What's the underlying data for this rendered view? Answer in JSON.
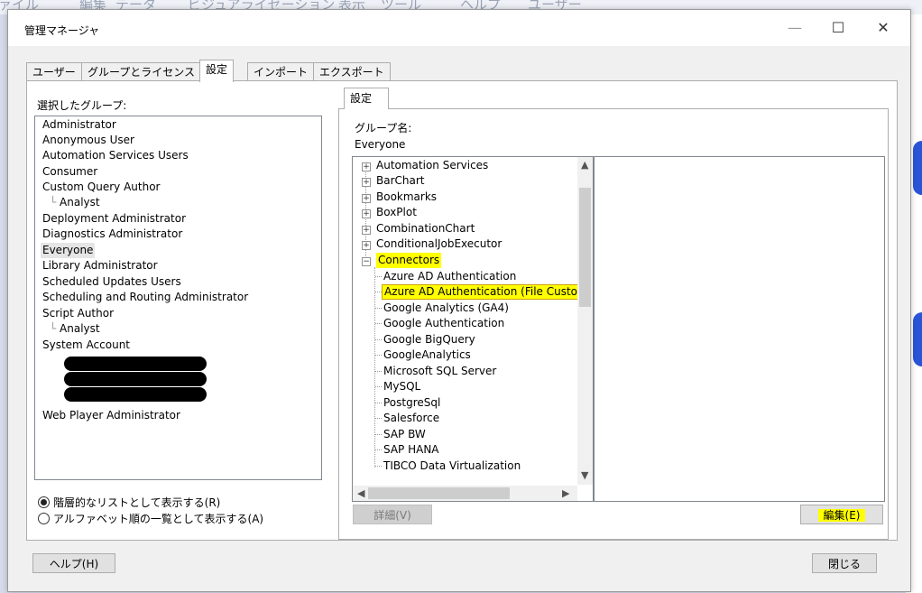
{
  "background_menu": [
    "ァイル",
    "編集",
    "データ",
    "ビジュアライゼーション",
    "表示",
    "ツール",
    "ヘルプ",
    "ユーザー"
  ],
  "window": {
    "title": "管理マネージャ",
    "minimize": "—",
    "maximize": "☐",
    "close": "✕"
  },
  "tabs": [
    "ユーザー",
    "グループとライセンス",
    "設定",
    "インポート",
    "エクスポート"
  ],
  "left": {
    "label": "選択したグループ:",
    "groups": [
      "Administrator",
      "Anonymous User",
      "Automation Services Users",
      "Consumer",
      "Custom Query Author",
      "Analyst",
      "Deployment Administrator",
      "Diagnostics Administrator",
      "Everyone",
      "Library Administrator",
      "Scheduled Updates Users",
      "Scheduling and Routing Administrator",
      "Script Author",
      "Analyst",
      "System Account",
      "Web Player Administrator"
    ],
    "selected": "Everyone",
    "radio_hierarchy": "階層的なリストとして表示する(R)",
    "radio_alpha": "アルファベット順の一覧として表示する(A)"
  },
  "settings": {
    "subtab": "設定",
    "group_name_label": "グループ名:",
    "group_name": "Everyone",
    "tree_top": [
      "Automation Services",
      "BarChart",
      "Bookmarks",
      "BoxPlot",
      "CombinationChart",
      "ConditionalJobExecutor"
    ],
    "tree_expanded": "Connectors",
    "connectors": [
      "Azure AD Authentication",
      "Azure AD Authentication (File Custom)",
      "Google Analytics (GA4)",
      "Google Authentication",
      "Google BigQuery",
      "GoogleAnalytics",
      "Microsoft SQL Server",
      "MySQL",
      "PostgreSql",
      "Salesforce",
      "SAP BW",
      "SAP HANA",
      "TIBCO Data Virtualization"
    ],
    "highlighted_connector": "Azure AD Authentication (File Custom)",
    "highlight_color": "#ffff00",
    "details_button": "詳細(V)",
    "edit_button": "編集(E)"
  },
  "footer": {
    "help_button": "ヘルプ(H)",
    "close_button": "閉じる"
  }
}
